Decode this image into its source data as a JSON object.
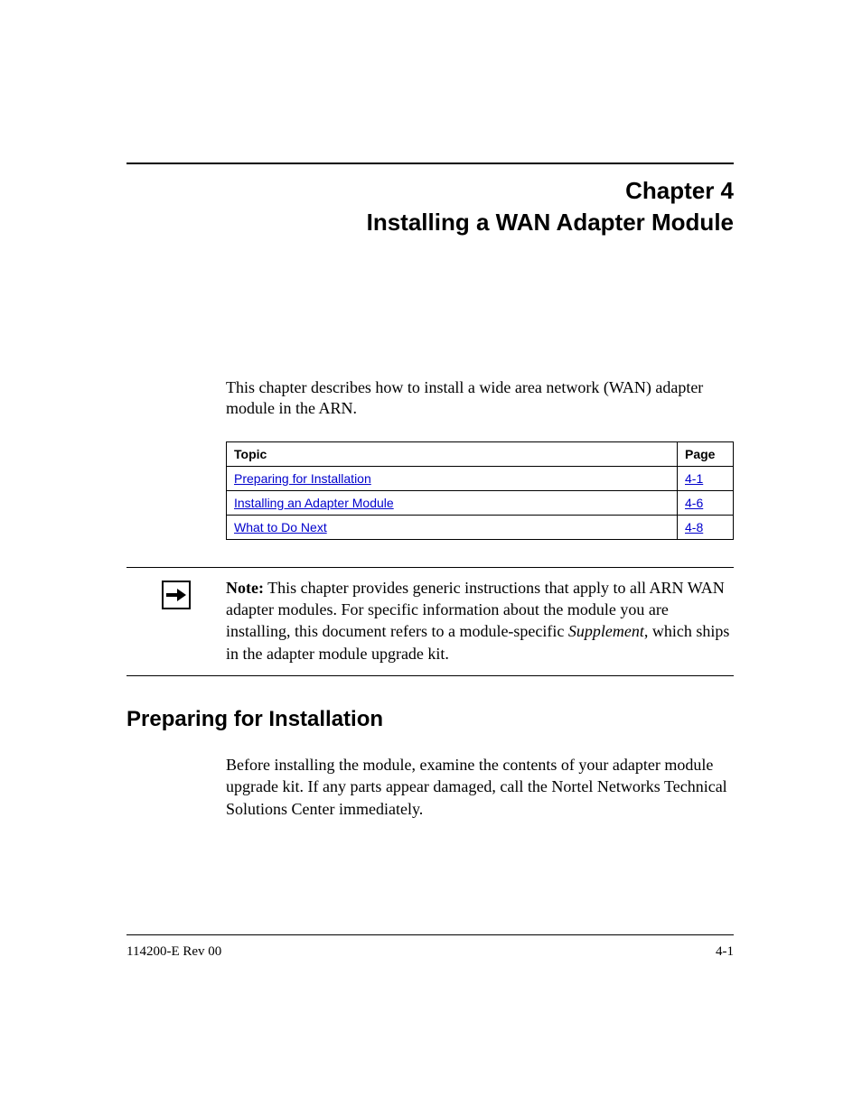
{
  "chapter": {
    "number_label": "Chapter 4",
    "title": "Installing a WAN Adapter Module"
  },
  "intro": "This chapter describes how to install a wide area network (WAN) adapter module in the ARN.",
  "toc": {
    "headers": {
      "topic": "Topic",
      "page": "Page"
    },
    "rows": [
      {
        "topic": "Preparing for Installation",
        "page": "4-1"
      },
      {
        "topic": "Installing an Adapter Module",
        "page": "4-6"
      },
      {
        "topic": "What to Do Next",
        "page": "4-8"
      }
    ]
  },
  "note": {
    "label": "Note:",
    "before_italic": " This chapter provides generic instructions that apply to all ARN WAN adapter modules. For specific information about the module you are installing, this document refers to a module-specific ",
    "italic": "Supplement",
    "after_italic": ", which ships in the adapter module upgrade kit."
  },
  "section": {
    "heading": "Preparing for Installation",
    "body": "Before installing the module, examine the contents of your adapter module upgrade kit. If any parts appear damaged, call the Nortel Networks Technical Solutions Center immediately."
  },
  "footer": {
    "left": "114200-E Rev 00",
    "right": "4-1"
  }
}
